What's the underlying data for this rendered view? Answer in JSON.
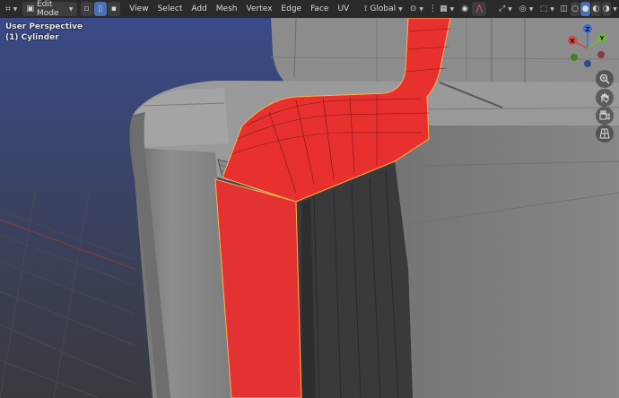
{
  "header": {
    "mode_label": "Edit Mode",
    "menus": [
      "View",
      "Select",
      "Add",
      "Mesh",
      "Vertex",
      "Edge",
      "Face",
      "UV"
    ],
    "orientation_label": "Global"
  },
  "viewport": {
    "view_name": "User Perspective",
    "object_name": "(1) Cylinder"
  },
  "gizmo": {
    "z_label": "Z",
    "y_label": "Y",
    "x_label": "X"
  },
  "colors": {
    "selected_face": "#e8302f",
    "mesh_face": "#8a8a8a",
    "background_top": "#3a4a8c",
    "active_button": "#4772b3"
  }
}
